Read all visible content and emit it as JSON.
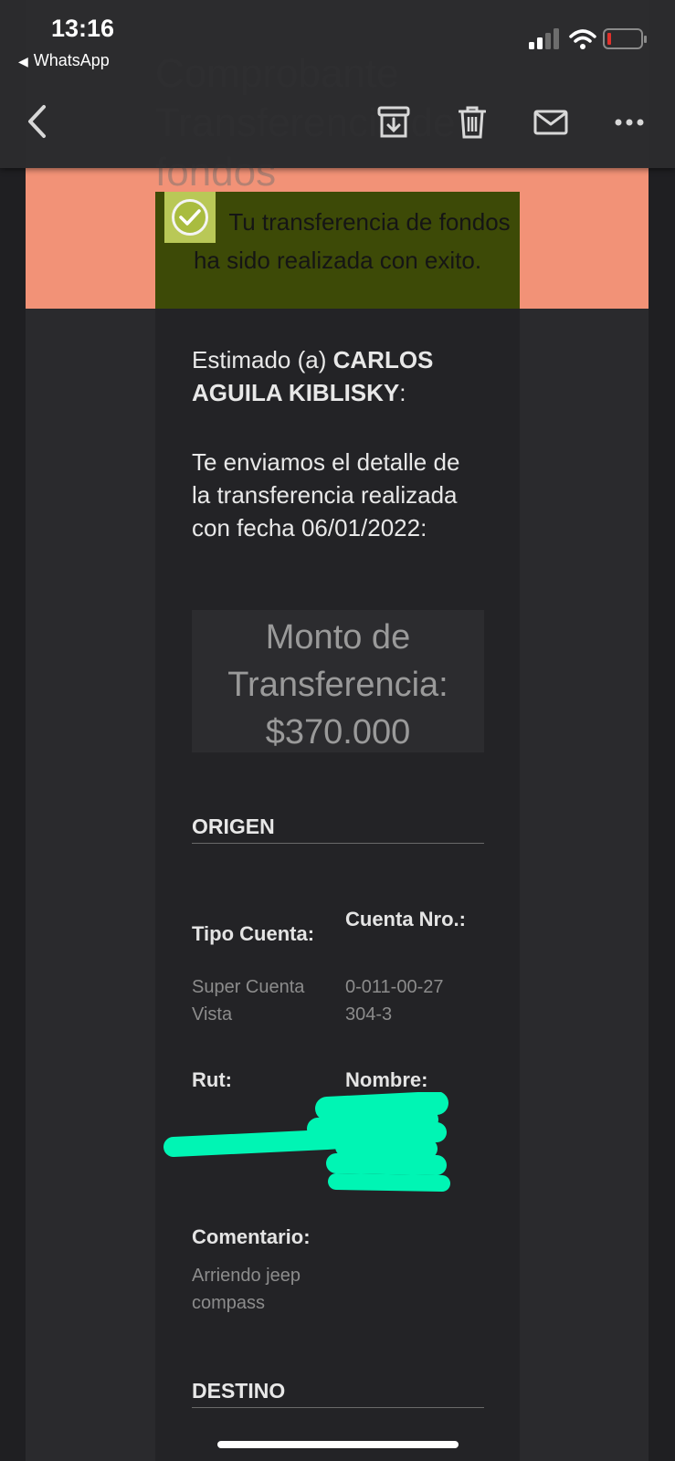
{
  "status_bar": {
    "time": "13:16",
    "back_app": "WhatsApp"
  },
  "nav": {
    "icons": [
      "back-chevron-icon",
      "archive-icon",
      "trash-icon",
      "mail-icon",
      "more-icon"
    ]
  },
  "email": {
    "title_faded": "Comprobante\nTransferencia de\nfondos",
    "success_message": "Tu transferencia de fondos ha sido realizada con exito.",
    "greeting_prefix": "Estimado (a) ",
    "recipient_name": "CARLOS AGUILA KIBLISKY",
    "greeting_suffix": ":",
    "detail_text": "Te enviamos el detalle de la transferencia realizada con fecha 06/01/2022:",
    "amount_label": "Monto de Transferencia:",
    "amount_value": "$370.000",
    "origen": {
      "heading": "ORIGEN",
      "tipo_cuenta_label": "Tipo Cuenta:",
      "tipo_cuenta_value": "Super Cuenta Vista",
      "cuenta_nro_label": "Cuenta Nro.:",
      "cuenta_nro_value": "0-011-00-27304-3",
      "rut_label": "Rut:",
      "nombre_label": "Nombre:",
      "comentario_label": "Comentario:",
      "comentario_value": "Arriendo jeep compass"
    },
    "destino": {
      "heading": "DESTINO"
    }
  },
  "colors": {
    "salmon_band": "#f29277",
    "success_bg": "#3d4a07",
    "redaction": "#00f5b4",
    "battery_low": "#e0312b"
  }
}
